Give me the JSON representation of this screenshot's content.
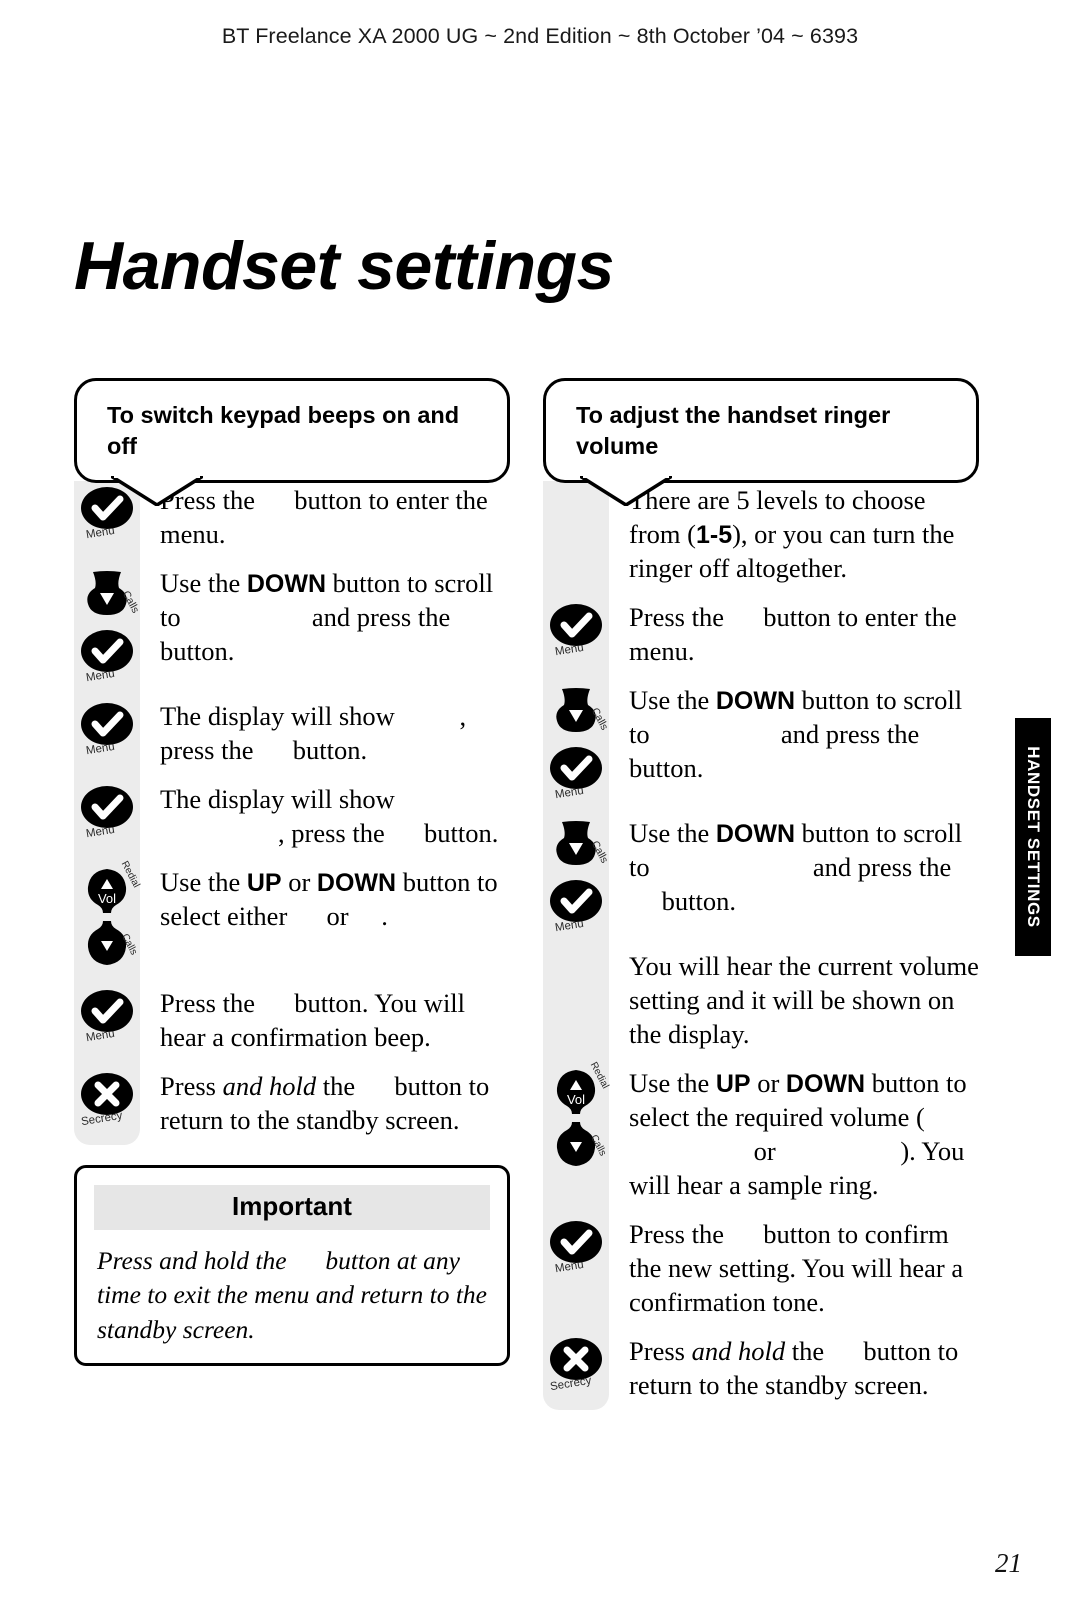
{
  "header": {
    "running_head": "BT Freelance XA 2000 UG ~ 2nd Edition ~ 8th October ’04 ~ 6393"
  },
  "page": {
    "title": "Handset settings",
    "folio": "21",
    "thumb_tab": "HANDSET SETTINGS"
  },
  "left_column": {
    "callout_title": "To switch keypad beeps on and off",
    "steps": [
      {
        "icon": "menu-key-icon",
        "icon_label": "Menu",
        "text_parts": [
          {
            "t": "Press the ",
            "style": "normal"
          },
          {
            "t": "",
            "style": "gap-sm"
          },
          {
            "t": " button to enter the menu.",
            "style": "normal"
          }
        ]
      },
      {
        "icon": "down-key-then-menu-key-icon",
        "icon_label": "Calls / Menu",
        "text_parts": [
          {
            "t": "Use the ",
            "style": "normal"
          },
          {
            "t": "DOWN",
            "style": "bold"
          },
          {
            "t": " button to scroll to ",
            "style": "normal"
          },
          {
            "t": "",
            "style": "gap-lg"
          },
          {
            "t": " and press the ",
            "style": "normal"
          },
          {
            "t": "",
            "style": "gap-sm"
          },
          {
            "t": " button.",
            "style": "normal"
          }
        ]
      },
      {
        "icon": "menu-key-icon",
        "icon_label": "Menu",
        "text_parts": [
          {
            "t": "The display will show ",
            "style": "normal"
          },
          {
            "t": "",
            "style": "gap-md"
          },
          {
            "t": ", press the ",
            "style": "normal"
          },
          {
            "t": "",
            "style": "gap-sm"
          },
          {
            "t": " button.",
            "style": "normal"
          }
        ]
      },
      {
        "icon": "menu-key-icon",
        "icon_label": "Menu",
        "text_parts": [
          {
            "t": "The display will show ",
            "style": "normal"
          },
          {
            "t": "",
            "style": "gap-lg"
          },
          {
            "t": ", press the ",
            "style": "normal"
          },
          {
            "t": "",
            "style": "gap-sm"
          },
          {
            "t": " button.",
            "style": "normal"
          }
        ]
      },
      {
        "icon": "volume-rocker-icon",
        "icon_label": "Redial / Vol / Calls",
        "text_parts": [
          {
            "t": "Use the ",
            "style": "normal"
          },
          {
            "t": "UP",
            "style": "bold"
          },
          {
            "t": " or ",
            "style": "normal"
          },
          {
            "t": "DOWN",
            "style": "bold"
          },
          {
            "t": " button to select either ",
            "style": "normal"
          },
          {
            "t": "",
            "style": "gap-sm"
          },
          {
            "t": " or ",
            "style": "normal"
          },
          {
            "t": "",
            "style": "gap-sm"
          },
          {
            "t": ".",
            "style": "normal"
          }
        ]
      },
      {
        "icon": "menu-key-icon",
        "icon_label": "Menu",
        "text_parts": [
          {
            "t": "Press the ",
            "style": "normal"
          },
          {
            "t": "",
            "style": "gap-sm"
          },
          {
            "t": " button. You will hear a confirmation beep.",
            "style": "normal"
          }
        ]
      },
      {
        "icon": "secrecy-key-icon",
        "icon_label": "Secrecy",
        "text_parts": [
          {
            "t": "Press ",
            "style": "normal"
          },
          {
            "t": "and hold",
            "style": "italic"
          },
          {
            "t": " the ",
            "style": "normal"
          },
          {
            "t": "",
            "style": "gap-sm"
          },
          {
            "t": " button to return to the standby screen.",
            "style": "normal"
          }
        ]
      }
    ],
    "important": {
      "heading": "Important",
      "body_parts": [
        {
          "t": "Press and hold the ",
          "style": "normal"
        },
        {
          "t": "",
          "style": "gap-sm"
        },
        {
          "t": " button at any time to exit the menu and return to the standby screen.",
          "style": "normal"
        }
      ]
    }
  },
  "right_column": {
    "callout_title": "To adjust the handset ringer volume",
    "steps": [
      {
        "icon": "none",
        "icon_label": "",
        "text_parts": [
          {
            "t": "There are 5 levels to choose from (",
            "style": "normal"
          },
          {
            "t": "1-5",
            "style": "bold"
          },
          {
            "t": "), or you can turn the ringer off altogether.",
            "style": "normal"
          }
        ]
      },
      {
        "icon": "menu-key-icon",
        "icon_label": "Menu",
        "text_parts": [
          {
            "t": "Press the ",
            "style": "normal"
          },
          {
            "t": "",
            "style": "gap-sm"
          },
          {
            "t": " button to enter the menu.",
            "style": "normal"
          }
        ]
      },
      {
        "icon": "down-key-then-menu-key-icon",
        "icon_label": "Calls / Menu",
        "text_parts": [
          {
            "t": "Use the ",
            "style": "normal"
          },
          {
            "t": "DOWN",
            "style": "bold"
          },
          {
            "t": " button to scroll to ",
            "style": "normal"
          },
          {
            "t": "",
            "style": "gap-lg"
          },
          {
            "t": " and press the ",
            "style": "normal"
          },
          {
            "t": "",
            "style": "gap-sm"
          },
          {
            "t": " button.",
            "style": "normal"
          }
        ]
      },
      {
        "icon": "down-key-then-menu-key-icon",
        "icon_label": "Calls / Menu",
        "text_parts": [
          {
            "t": "Use the ",
            "style": "normal"
          },
          {
            "t": "DOWN",
            "style": "bold"
          },
          {
            "t": " button to scroll to ",
            "style": "normal"
          },
          {
            "t": "",
            "style": "gap-xl"
          },
          {
            "t": " and press the ",
            "style": "normal"
          },
          {
            "t": "",
            "style": "gap-sm"
          },
          {
            "t": " button.",
            "style": "normal"
          }
        ]
      },
      {
        "icon": "none",
        "icon_label": "",
        "text_parts": [
          {
            "t": "You will hear the current volume setting and it will be shown on the display.",
            "style": "normal"
          }
        ]
      },
      {
        "icon": "volume-rocker-icon",
        "icon_label": "Redial / Vol / Calls",
        "text_parts": [
          {
            "t": "Use the ",
            "style": "normal"
          },
          {
            "t": "UP",
            "style": "bold"
          },
          {
            "t": " or ",
            "style": "normal"
          },
          {
            "t": "DOWN",
            "style": "bold"
          },
          {
            "t": " button to select the required volume (",
            "style": "normal"
          },
          {
            "t": "",
            "style": "gap-lg"
          },
          {
            "t": " or ",
            "style": "normal"
          },
          {
            "t": "",
            "style": "gap-lg"
          },
          {
            "t": "). You will hear a sample ring.",
            "style": "normal"
          }
        ]
      },
      {
        "icon": "menu-key-icon",
        "icon_label": "Menu",
        "text_parts": [
          {
            "t": "Press the ",
            "style": "normal"
          },
          {
            "t": "",
            "style": "gap-sm"
          },
          {
            "t": " button to confirm the new setting. You will hear a confirmation tone.",
            "style": "normal"
          }
        ]
      },
      {
        "icon": "secrecy-key-icon",
        "icon_label": "Secrecy",
        "text_parts": [
          {
            "t": "Press ",
            "style": "normal"
          },
          {
            "t": "and hold",
            "style": "italic"
          },
          {
            "t": " the ",
            "style": "normal"
          },
          {
            "t": "",
            "style": "gap-sm"
          },
          {
            "t": " button to return to the standby screen.",
            "style": "normal"
          }
        ]
      }
    ]
  },
  "icon_labels": {
    "menu": "Menu",
    "calls": "Calls",
    "redial": "Redial",
    "vol": "Vol",
    "secrecy": "Secrecy"
  },
  "colors": {
    "gutter": "#ececec",
    "important_head": "#e6e6e6",
    "tab": "#000000",
    "ink": "#000000"
  }
}
